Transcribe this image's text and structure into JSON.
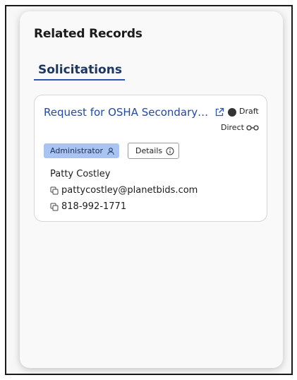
{
  "panel": {
    "title": "Related Records",
    "tab_label": "Solicitations"
  },
  "record": {
    "title": "Request for OSHA Secondary Containment",
    "status": "Draft",
    "type": "Direct",
    "role_badge": "Administrator",
    "details_label": "Details",
    "contact": {
      "name": "Patty Costley",
      "email": "pattycostley@planetbids.com",
      "phone": "818-992-1771"
    }
  },
  "colors": {
    "link_blue": "#234aa0",
    "tab_underline": "#2a55b3",
    "badge_bg": "#a9c4f3",
    "status_dot": "#333333"
  },
  "icons": {
    "external": "external-link-icon",
    "status": "status-dot-icon",
    "link_type": "key-connector-icon",
    "role": "user-icon",
    "details": "info-icon",
    "copy": "copy-icon"
  }
}
